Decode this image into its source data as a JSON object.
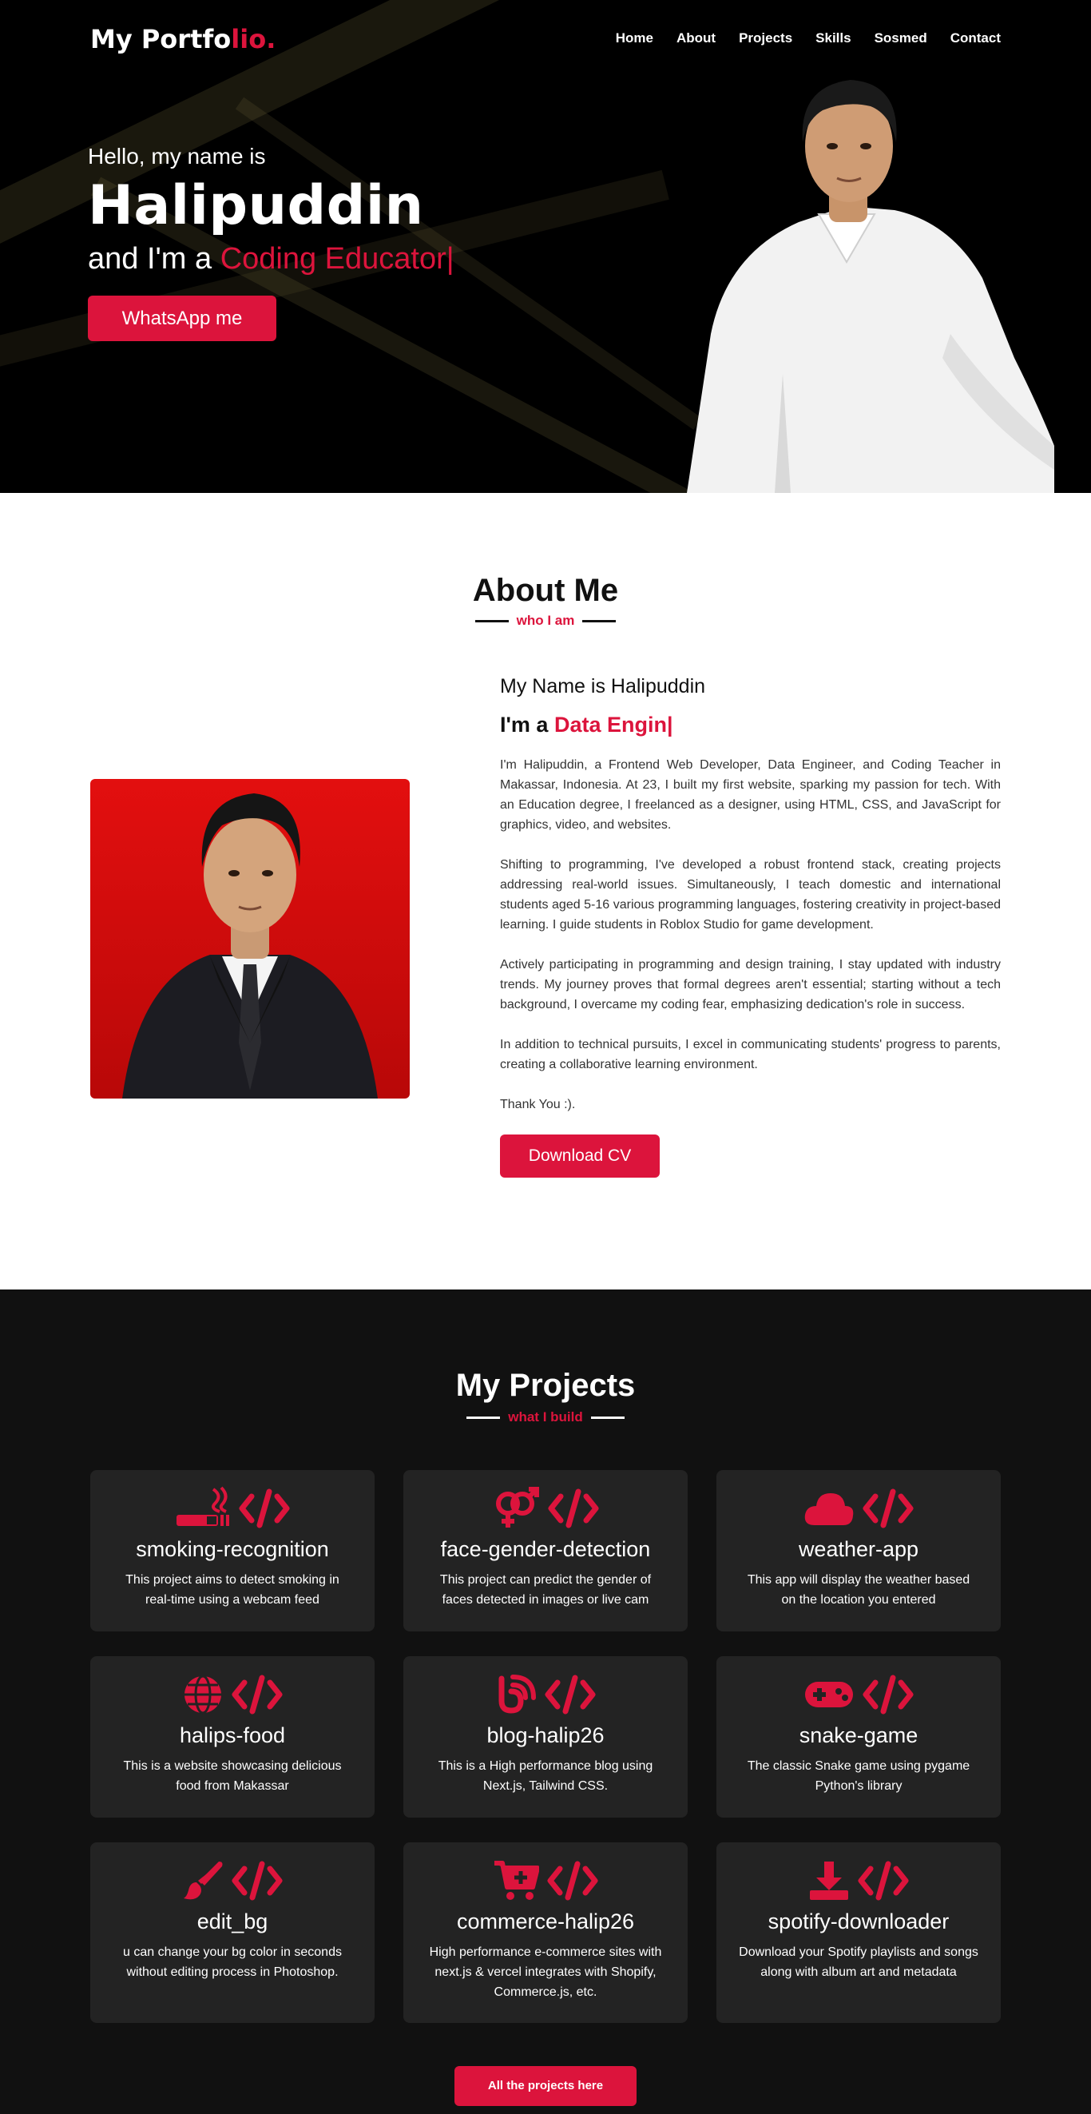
{
  "nav": {
    "logo_main": "My Portfo",
    "logo_accent": "lio.",
    "items": [
      "Home",
      "About",
      "Projects",
      "Skills",
      "Sosmed",
      "Contact"
    ]
  },
  "hero": {
    "greeting": "Hello, my name is",
    "name": "Halipuddin",
    "role_prefix": "and I'm a ",
    "role_accent": "Coding Educator|",
    "button": "WhatsApp me"
  },
  "about": {
    "title": "About Me",
    "subtitle": "who I am",
    "name_line": "My Name is Halipuddin",
    "role_prefix": "I'm a ",
    "role_accent": "Data Engin|",
    "paragraphs": [
      "I'm Halipuddin, a Frontend Web Developer, Data Engineer, and Coding Teacher in Makassar, Indonesia. At 23, I built my first website, sparking my passion for tech. With an Education degree, I freelanced as a designer, using HTML, CSS, and JavaScript for graphics, video, and websites.",
      "Shifting to programming, I've developed a robust frontend stack, creating projects addressing real-world issues. Simultaneously, I teach domestic and international students aged 5-16 various programming languages, fostering creativity in project-based learning. I guide students in Roblox Studio for game development.",
      "Actively participating in programming and design training, I stay updated with industry trends. My journey proves that formal degrees aren't essential; starting without a tech background, I overcame my coding fear, emphasizing dedication's role in success.",
      "In addition to technical pursuits, I excel in communicating students' progress to parents, creating a collaborative learning environment.",
      "Thank You :)."
    ],
    "button": "Download CV"
  },
  "projects": {
    "title": "My Projects",
    "subtitle": "what I build",
    "items": [
      {
        "title": "smoking-recognition",
        "desc": "This project aims to detect smoking in real-time using a webcam feed",
        "icon": "smoking-icon"
      },
      {
        "title": "face-gender-detection",
        "desc": "This project can predict the gender of faces detected in images or live cam",
        "icon": "gender-icon"
      },
      {
        "title": "weather-app",
        "desc": "This app will display the weather based on the location you entered",
        "icon": "cloud-icon"
      },
      {
        "title": "halips-food",
        "desc": "This is a website showcasing delicious food from Makassar",
        "icon": "globe-icon"
      },
      {
        "title": "blog-halip26",
        "desc": "This is a High performance blog using Next.js, Tailwind CSS.",
        "icon": "blog-icon"
      },
      {
        "title": "snake-game",
        "desc": "The classic Snake game using pygame Python's library",
        "icon": "gamepad-icon"
      },
      {
        "title": "edit_bg",
        "desc": "u can change your bg color in seconds without editing process in Photoshop.",
        "icon": "paintbrush-icon"
      },
      {
        "title": "commerce-halip26",
        "desc": "High performance e-commerce sites with next.js & vercel integrates with Shopify, Commerce.js, etc.",
        "icon": "cart-plus-icon"
      },
      {
        "title": "spotify-downloader",
        "desc": "Download your Spotify playlists and songs along with album art and metadata",
        "icon": "download-icon"
      }
    ],
    "button": "All the projects here"
  },
  "colors": {
    "accent": "#dc143c",
    "dark": "#111111",
    "card": "#232323"
  }
}
